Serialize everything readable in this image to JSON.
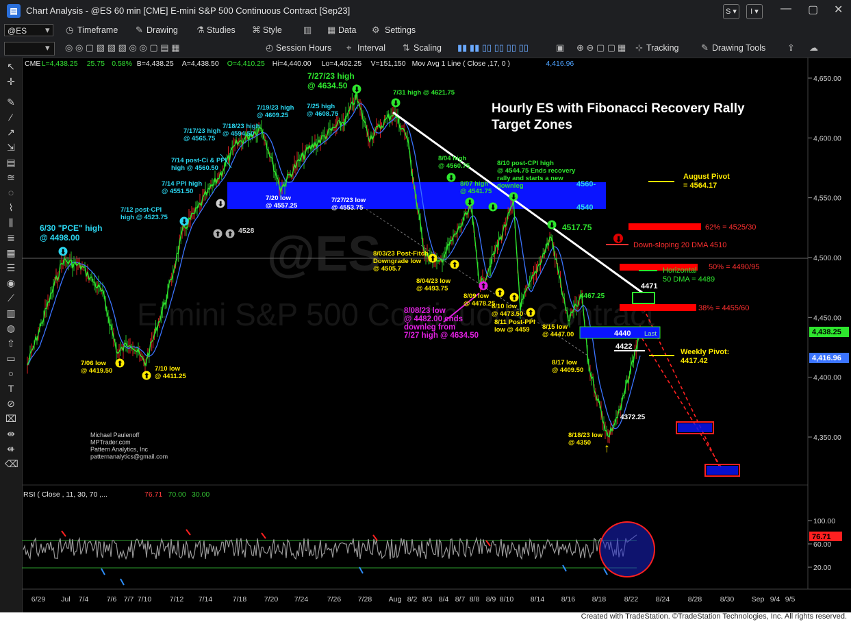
{
  "window": {
    "title": "Chart Analysis - @ES 60 min [CME] E-mini S&P 500 Continuous Contract [Sep23]",
    "btn_s": "S",
    "btn_i": "I"
  },
  "toolbar1": {
    "symbol": "@ES",
    "timeframe": "Timeframe",
    "drawing": "Drawing",
    "studies": "Studies",
    "style": "Style",
    "data": "Data",
    "settings": "Settings"
  },
  "toolbar2": {
    "session": "Session Hours",
    "interval": "Interval",
    "scaling": "Scaling",
    "tracking": "Tracking",
    "drawing_tools": "Drawing Tools"
  },
  "header_line": [
    {
      "text": "CME",
      "color": "#e8e8e8"
    },
    {
      "text": "L=4,438.25",
      "color": "#33e233"
    },
    {
      "text": "25.75",
      "color": "#33e233"
    },
    {
      "text": "0.58%",
      "color": "#33e233"
    },
    {
      "text": "B=4,438.25",
      "color": "#e8e8e8"
    },
    {
      "text": "A=4,438.50",
      "color": "#e8e8e8"
    },
    {
      "text": "O=4,410.25",
      "color": "#33e233"
    },
    {
      "text": "Hi=4,440.00",
      "color": "#e8e8e8"
    },
    {
      "text": "Lo=4,402.25",
      "color": "#e8e8e8"
    },
    {
      "text": "V=151,150",
      "color": "#e8e8e8"
    },
    {
      "text": "Mov Avg 1 Line ( Close ,17,  0 )",
      "color": "#e8e8e8"
    },
    {
      "text": "4,416.96",
      "color": "#4ea3ff"
    }
  ],
  "chart_title": [
    "Hourly ES with Fibonacci Recovery Rally",
    "Target Zones"
  ],
  "watermark": "@ES",
  "watermark2": "E-mini S&P 500 Continuous Contract",
  "author": [
    "Michael Paulenoff",
    "MPTrader.com",
    "Pattern Analytics, Inc",
    "patternanalytics@gmail.com"
  ],
  "price_axis": [
    "4,650.00",
    "4,600.00",
    "4,550.00",
    "4,500.00",
    "4,450.00",
    "4,400.00",
    "4,350.00"
  ],
  "last_price_tag": "4,438.25",
  "ma_price_tag": "4,416.96",
  "rsi_axis": [
    "100.00",
    "60.00",
    "20.00"
  ],
  "rsi_tag": "76.71",
  "rsi_header": [
    {
      "text": "RSI ( Close , 11, 30, 70 ,... ",
      "color": "#e8e8e8"
    },
    {
      "text": "76.71",
      "color": "#ff3b3b"
    },
    {
      "text": "70.00",
      "color": "#33c233"
    },
    {
      "text": "30.00",
      "color": "#33c233"
    }
  ],
  "date_axis": [
    "6/29",
    "Jul",
    "7/4",
    "7/6",
    "7/7",
    "7/10",
    "7/12",
    "7/14",
    "7/18",
    "7/20",
    "7/24",
    "7/26",
    "7/28",
    "Aug",
    "8/2",
    "8/3",
    "8/4",
    "8/7",
    "8/8",
    "8/9",
    "8/10",
    "8/14",
    "8/16",
    "8/18",
    "8/22",
    "8/24",
    "8/28",
    "8/30",
    "Sep",
    "9/4",
    "9/5"
  ],
  "annotations": {
    "a630": [
      "6/30 \"PCE\" high",
      "@ 4498.00"
    ],
    "a706": [
      "7/06 low",
      "@ 4419.50"
    ],
    "a710": [
      "7/10 low",
      "@ 4411.25"
    ],
    "a712": [
      "7/12 post-CPI",
      "high @ 4523.75"
    ],
    "a714ppi": [
      "7/14 PPI high",
      "@ 4551.50"
    ],
    "a714ci": [
      "7/14 post-Ci & PPI",
      "high @ 4560.50"
    ],
    "a717": [
      "7/17/23 high",
      "@ 4565.75"
    ],
    "a718": [
      "7/18/23 high",
      "@ 4594.50"
    ],
    "a719": [
      "7/19/23 high",
      "@ 4609.25"
    ],
    "a725": [
      "7/25 high",
      "@ 4608.75"
    ],
    "a727h": [
      "7/27/23 high",
      "@ 4634.50"
    ],
    "a731": [
      "7/31 high @ 4621.75"
    ],
    "a720l": [
      "7/20 low",
      "@ 4557.25"
    ],
    "a727l": [
      "7/27/23 low",
      "@ 4553.75"
    ],
    "a4528": "4528",
    "a803": [
      "8/03/23 Post-Fitch",
      "Downgrade low",
      "@ 4505.7"
    ],
    "a804l": [
      "8/04/23 low",
      "@ 4493.75"
    ],
    "a804h": [
      "8/04 high",
      "@ 4560.75"
    ],
    "a807": [
      "8/07 high",
      "@ 4541.75"
    ],
    "a809": [
      "8/09 low",
      "@ 4478.25"
    ],
    "a810l": [
      "8/10 low",
      "@ 4473.50"
    ],
    "a810h": [
      "8/10 post-CPI high",
      "@ 4544.75 Ends recovery",
      "rally and starts a new",
      "downleg"
    ],
    "a811": [
      "8/11 Post-PPI",
      "low @ 4459"
    ],
    "a808": [
      "8/08/23 low",
      "@ 4482.00 ends",
      "downleg from",
      "7/27 high @ 4634.50"
    ],
    "a815": [
      "8/15 low",
      "@ 4447.00"
    ],
    "a817": [
      "8/17 low",
      "@ 4409.50"
    ],
    "a818": [
      "8/18/23 low",
      "@ 4350"
    ],
    "a4372": "4372.25",
    "a4467": "4467.25",
    "a4517": "4517.75",
    "band_top": "4560-",
    "band_bot": "4540",
    "aug_pivot": [
      "August Pivot",
      "= 4564.17"
    ],
    "fib62": "62% = 4525/30",
    "ma20": "Down-sloping 20 DMA 4510",
    "fib50": "50% = 4490/95",
    "ma50": [
      "Horizontal",
      "50 DMA = 4489"
    ],
    "fib38": "38% = 4455/60",
    "box4471": "4471",
    "box4440": "4440",
    "last": "Last",
    "box4422": "4422",
    "weekly_pivot": [
      "Weekly Pivot:",
      "4417.42"
    ]
  },
  "chart_data": {
    "type": "line",
    "title": "Hourly ES with Fibonacci Recovery Rally Target Zones",
    "xlabel": "",
    "ylabel": "",
    "ylim": [
      4305,
      4660
    ],
    "series": [
      {
        "name": "",
        "x": [
          "6/29",
          "6/30",
          "7/3",
          "7/5",
          "7/6",
          "7/7",
          "7/10",
          "7/11",
          "7/12",
          "7/13",
          "7/14",
          "7/17",
          "7/18",
          "7/19",
          "7/20",
          "7/21",
          "7/24",
          "7/25",
          "7/26",
          "7/27",
          "7/28",
          "7/31",
          "8/1",
          "8/2",
          "8/3",
          "8/4",
          "8/7",
          "8/8",
          "8/9",
          "8/10",
          "8/11",
          "8/14",
          "8/15",
          "8/16",
          "8/17",
          "8/18",
          "8/21",
          "8/22"
        ],
        "values": [
          4410,
          4498,
          4492,
          4470,
          4419.5,
          4430,
          4411.25,
          4470,
          4523.75,
          4540,
          4551.5,
          4565.75,
          4594.5,
          4609.25,
          4557.25,
          4575,
          4590,
          4608.75,
          4615,
          4634.5,
          4600,
          4621.75,
          4600,
          4540,
          4505.7,
          4493.75,
          4541.75,
          4482,
          4478.25,
          4544.75,
          4459,
          4517.75,
          4447,
          4467.25,
          4409.5,
          4350,
          4372.25,
          4438.25
        ]
      }
    ],
    "levels": [
      {
        "label": "August Pivot",
        "value": 4564.17
      },
      {
        "label": "62%",
        "value": 4527.5
      },
      {
        "label": "Down-sloping 20 DMA",
        "value": 4510
      },
      {
        "label": "50%",
        "value": 4492.5
      },
      {
        "label": "Horizontal 50 DMA",
        "value": 4489
      },
      {
        "label": "38%",
        "value": 4457.5
      },
      {
        "label": "Weekly Pivot",
        "value": 4417.42
      }
    ],
    "resistance_zone": [
      4540,
      4560
    ],
    "rsi": {
      "last": 76.71,
      "overbought": 70,
      "oversold": 30
    }
  }
}
